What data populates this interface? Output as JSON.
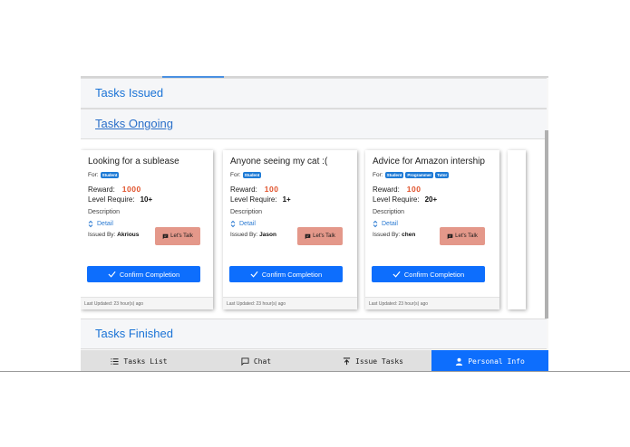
{
  "sections": {
    "issued": "Tasks Issued",
    "ongoing": "Tasks Ongoing",
    "finished": "Tasks Finished"
  },
  "labels": {
    "for": "For:",
    "reward": "Reward:",
    "level": "Level Require:",
    "description": "Description",
    "detail": "Detail",
    "issued_by": "Issued By:",
    "talk": "Let's Talk",
    "confirm": "Confirm Completion",
    "updated": "Last Updated: 23 hour(s) ago"
  },
  "cards": [
    {
      "title": "Looking for a sublease",
      "tags": [
        "Student"
      ],
      "reward": "1000",
      "level": "10+",
      "issuer": "Akrious"
    },
    {
      "title": "Anyone seeing my cat :(",
      "tags": [
        "Student"
      ],
      "reward": "100",
      "level": "1+",
      "issuer": "Jason"
    },
    {
      "title": "Advice for Amazon intership",
      "tags": [
        "Student",
        "Programmer",
        "Tutor"
      ],
      "reward": "100",
      "level": "20+",
      "issuer": "chen"
    }
  ],
  "nav": [
    {
      "label": "Tasks List",
      "icon": "list-icon"
    },
    {
      "label": "Chat",
      "icon": "chat-icon"
    },
    {
      "label": "Issue Tasks",
      "icon": "upload-icon"
    },
    {
      "label": "Personal Info",
      "icon": "person-icon",
      "active": true
    }
  ],
  "colors": {
    "accent": "#0d6efd",
    "reward": "#e0522b",
    "talk_button": "#e4988a",
    "section_title": "#1a73d6"
  }
}
